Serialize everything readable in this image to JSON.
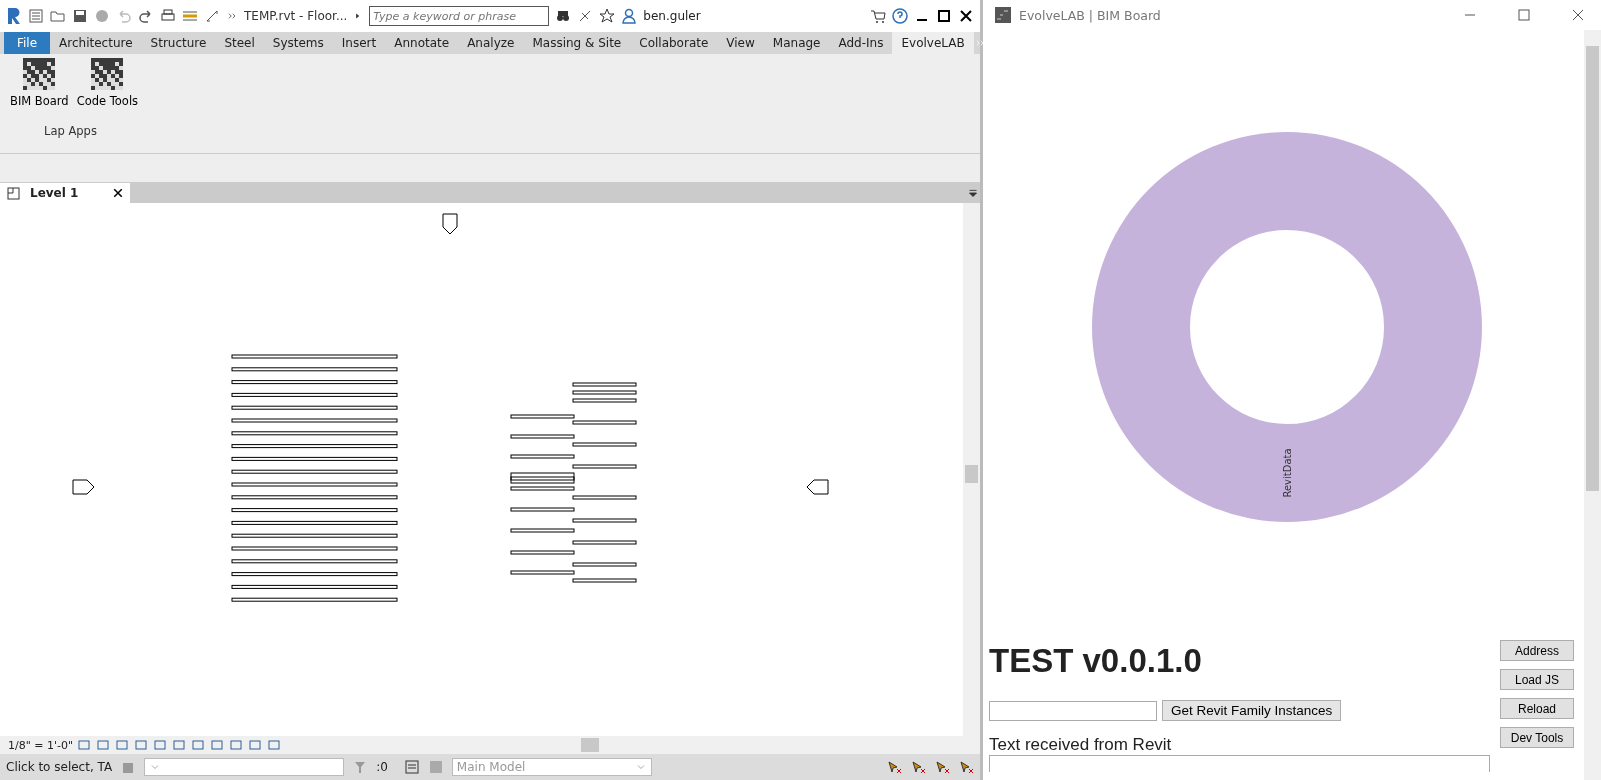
{
  "revit": {
    "title": "TEMP.rvt - Floor...",
    "search": {
      "placeholder": "Type a keyword or phrase"
    },
    "user": "ben.guler",
    "tabs": [
      {
        "label": "File",
        "kind": "file",
        "selected": false
      },
      {
        "label": "Architecture",
        "kind": "tab",
        "selected": false
      },
      {
        "label": "Structure",
        "kind": "tab",
        "selected": false
      },
      {
        "label": "Steel",
        "kind": "tab",
        "selected": false
      },
      {
        "label": "Systems",
        "kind": "tab",
        "selected": false
      },
      {
        "label": "Insert",
        "kind": "tab",
        "selected": false
      },
      {
        "label": "Annotate",
        "kind": "tab",
        "selected": false
      },
      {
        "label": "Analyze",
        "kind": "tab",
        "selected": false
      },
      {
        "label": "Massing & Site",
        "kind": "tab",
        "selected": false
      },
      {
        "label": "Collaborate",
        "kind": "tab",
        "selected": false
      },
      {
        "label": "View",
        "kind": "tab",
        "selected": false
      },
      {
        "label": "Manage",
        "kind": "tab",
        "selected": false
      },
      {
        "label": "Add-Ins",
        "kind": "tab",
        "selected": false
      },
      {
        "label": "EvolveLAB",
        "kind": "tab",
        "selected": true
      }
    ],
    "ribbon": {
      "buttons": [
        "BIM Board",
        "Code Tools"
      ],
      "panel_label": "Lap Apps"
    },
    "view_tab": {
      "label": "Level 1"
    },
    "view_bar": {
      "scale": "1/8\" = 1'-0\""
    },
    "status_bar": {
      "message": "Click to select, TA",
      "count": ":0",
      "model": {
        "value": "Main Model",
        "disabled": true
      }
    }
  },
  "bim_board": {
    "title": "EvolveLAB | BIM Board",
    "ring_label": "RevitData",
    "heading": "TEST v0.0.1.0",
    "action_button": "Get Revit Family Instances",
    "output_label": "Text received from Revit",
    "side_buttons": [
      "Address",
      "Load JS",
      "Reload",
      "Dev Tools"
    ]
  }
}
